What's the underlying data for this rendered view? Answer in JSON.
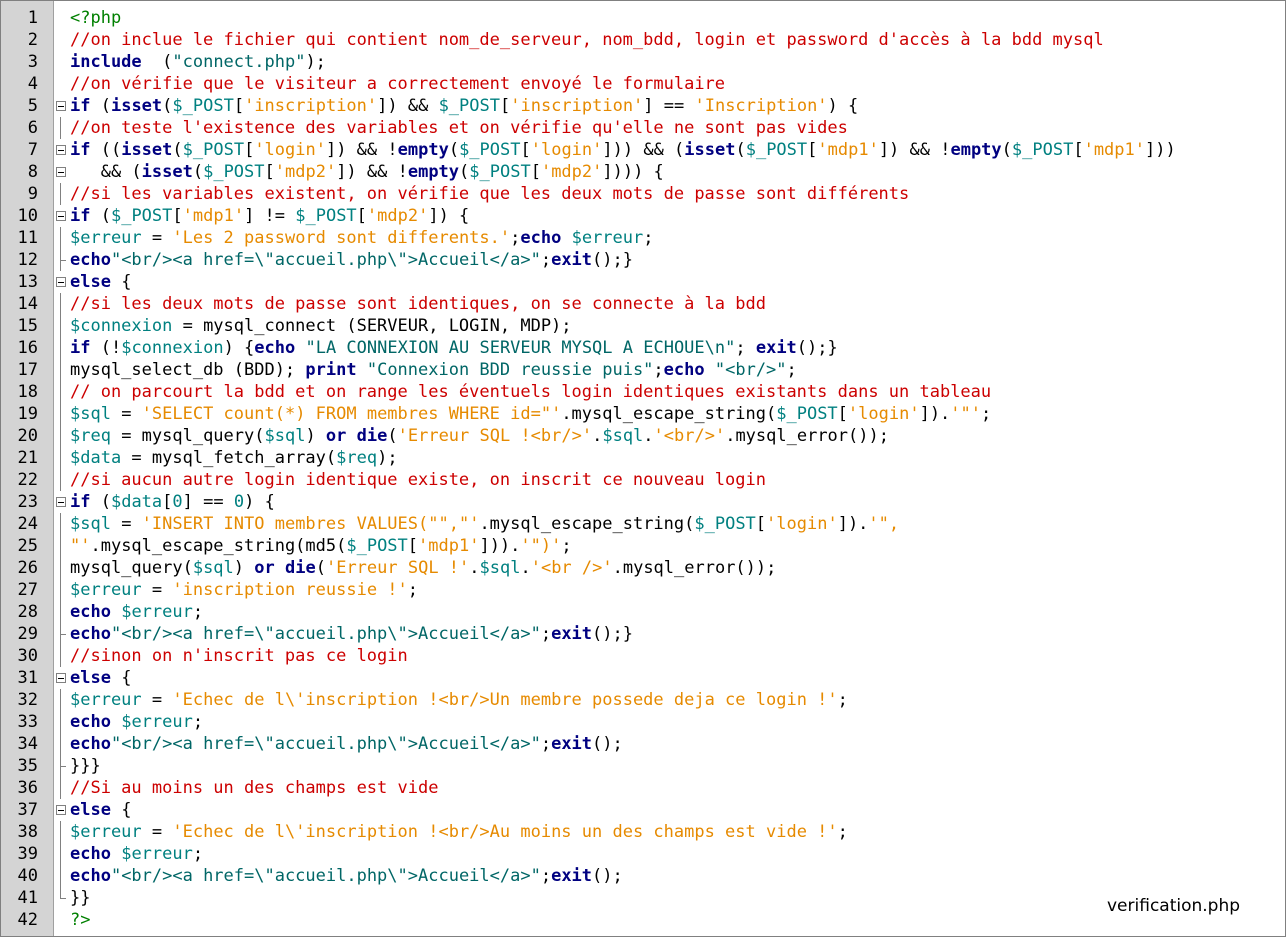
{
  "file": {
    "name": "verification.php"
  },
  "colors": {
    "comment": "#cc0000",
    "keyword": "#000080",
    "string_double": "#006666",
    "string_single": "#e68a00",
    "variable": "#008080",
    "php_tag": "#008000",
    "gutter_bg": "#d4d4d4"
  },
  "lines": [
    {
      "n": "1",
      "tokens": [
        [
          "tg",
          "<?php"
        ]
      ]
    },
    {
      "n": "2",
      "tokens": [
        [
          "cm",
          "//on inclue le fichier qui contient nom_de_serveur, nom_bdd, login et password d'accès à la bdd mysql"
        ]
      ]
    },
    {
      "n": "3",
      "tokens": [
        [
          "kw",
          "include"
        ],
        [
          "",
          "  ("
        ],
        [
          "st",
          "\"connect.php\""
        ],
        [
          "",
          ");"
        ]
      ]
    },
    {
      "n": "4",
      "tokens": [
        [
          "cm",
          "//on vérifie que le visiteur a correctement envoyé le formulaire"
        ]
      ]
    },
    {
      "n": "5",
      "tokens": [
        [
          "kw",
          "if"
        ],
        [
          "",
          " ("
        ],
        [
          "kw",
          "isset"
        ],
        [
          "",
          "("
        ],
        [
          "vr",
          "$_POST"
        ],
        [
          "",
          "["
        ],
        [
          "sq",
          "'inscription'"
        ],
        [
          "",
          "]) && "
        ],
        [
          "vr",
          "$_POST"
        ],
        [
          "",
          "["
        ],
        [
          "sq",
          "'inscription'"
        ],
        [
          "",
          "] == "
        ],
        [
          "sq",
          "'Inscription'"
        ],
        [
          "",
          ") {"
        ]
      ]
    },
    {
      "n": "6",
      "tokens": [
        [
          "cm",
          "//on teste l'existence des variables et on vérifie qu'elle ne sont pas vides"
        ]
      ]
    },
    {
      "n": "7",
      "tokens": [
        [
          "kw",
          "if"
        ],
        [
          "",
          " (("
        ],
        [
          "kw",
          "isset"
        ],
        [
          "",
          "("
        ],
        [
          "vr",
          "$_POST"
        ],
        [
          "",
          "["
        ],
        [
          "sq",
          "'login'"
        ],
        [
          "",
          "]) && !"
        ],
        [
          "kw",
          "empty"
        ],
        [
          "",
          "("
        ],
        [
          "vr",
          "$_POST"
        ],
        [
          "",
          "["
        ],
        [
          "sq",
          "'login'"
        ],
        [
          "",
          "])) && ("
        ],
        [
          "kw",
          "isset"
        ],
        [
          "",
          "("
        ],
        [
          "vr",
          "$_POST"
        ],
        [
          "",
          "["
        ],
        [
          "sq",
          "'mdp1'"
        ],
        [
          "",
          "]) && !"
        ],
        [
          "kw",
          "empty"
        ],
        [
          "",
          "("
        ],
        [
          "vr",
          "$_POST"
        ],
        [
          "",
          "["
        ],
        [
          "sq",
          "'mdp1'"
        ],
        [
          "",
          "]))"
        ]
      ]
    },
    {
      "n": "8",
      "tokens": [
        [
          "",
          "   && ("
        ],
        [
          "kw",
          "isset"
        ],
        [
          "",
          "("
        ],
        [
          "vr",
          "$_POST"
        ],
        [
          "",
          "["
        ],
        [
          "sq",
          "'mdp2'"
        ],
        [
          "",
          "]) && !"
        ],
        [
          "kw",
          "empty"
        ],
        [
          "",
          "("
        ],
        [
          "vr",
          "$_POST"
        ],
        [
          "",
          "["
        ],
        [
          "sq",
          "'mdp2'"
        ],
        [
          "",
          "]))) {"
        ]
      ]
    },
    {
      "n": "9",
      "tokens": [
        [
          "cm",
          "//si les variables existent, on vérifie que les deux mots de passe sont différents"
        ]
      ]
    },
    {
      "n": "10",
      "tokens": [
        [
          "kw",
          "if"
        ],
        [
          "",
          " ("
        ],
        [
          "vr",
          "$_POST"
        ],
        [
          "",
          "["
        ],
        [
          "sq",
          "'mdp1'"
        ],
        [
          "",
          "] != "
        ],
        [
          "vr",
          "$_POST"
        ],
        [
          "",
          "["
        ],
        [
          "sq",
          "'mdp2'"
        ],
        [
          "",
          "]) {"
        ]
      ]
    },
    {
      "n": "11",
      "tokens": [
        [
          "vr",
          "$erreur"
        ],
        [
          "",
          " = "
        ],
        [
          "sq",
          "'Les 2 password sont differents.'"
        ],
        [
          "",
          ";"
        ],
        [
          "kw",
          "echo"
        ],
        [
          "",
          " "
        ],
        [
          "vr",
          "$erreur"
        ],
        [
          "",
          ";"
        ]
      ]
    },
    {
      "n": "12",
      "tokens": [
        [
          "kw",
          "echo"
        ],
        [
          "st",
          "\"<br/><a href=\\\"accueil.php\\\">Accueil</a>\""
        ],
        [
          "",
          ";"
        ],
        [
          "kw",
          "exit"
        ],
        [
          "",
          "();}"
        ]
      ]
    },
    {
      "n": "13",
      "tokens": [
        [
          "kw",
          "else"
        ],
        [
          "",
          " {"
        ]
      ]
    },
    {
      "n": "14",
      "tokens": [
        [
          "cm",
          "//si les deux mots de passe sont identiques, on se connecte à la bdd"
        ]
      ]
    },
    {
      "n": "15",
      "tokens": [
        [
          "vr",
          "$connexion"
        ],
        [
          "",
          " = mysql_connect (SERVEUR, LOGIN, MDP);"
        ]
      ]
    },
    {
      "n": "16",
      "tokens": [
        [
          "kw",
          "if"
        ],
        [
          "",
          " (!"
        ],
        [
          "vr",
          "$connexion"
        ],
        [
          "",
          ") {"
        ],
        [
          "kw",
          "echo"
        ],
        [
          "",
          " "
        ],
        [
          "st",
          "\"LA CONNEXION AU SERVEUR MYSQL A ECHOUE\\n\""
        ],
        [
          "",
          "; "
        ],
        [
          "kw",
          "exit"
        ],
        [
          "",
          "();}"
        ]
      ]
    },
    {
      "n": "17",
      "tokens": [
        [
          "",
          "mysql_select_db (BDD); "
        ],
        [
          "kw",
          "print"
        ],
        [
          "",
          " "
        ],
        [
          "st",
          "\"Connexion BDD reussie puis\""
        ],
        [
          "",
          ";"
        ],
        [
          "kw",
          "echo"
        ],
        [
          "",
          " "
        ],
        [
          "st",
          "\"<br/>\""
        ],
        [
          "",
          ";"
        ]
      ]
    },
    {
      "n": "18",
      "tokens": [
        [
          "cm",
          "// on parcourt la bdd et on range les éventuels login identiques existants dans un tableau"
        ]
      ]
    },
    {
      "n": "19",
      "tokens": [
        [
          "vr",
          "$sql"
        ],
        [
          "",
          " = "
        ],
        [
          "sq",
          "'SELECT count(*) FROM membres WHERE id=\"'"
        ],
        [
          "",
          ".mysql_escape_string("
        ],
        [
          "vr",
          "$_POST"
        ],
        [
          "",
          "["
        ],
        [
          "sq",
          "'login'"
        ],
        [
          "",
          "])."
        ],
        [
          "sq",
          "'\"'"
        ],
        [
          "",
          ";"
        ]
      ]
    },
    {
      "n": "20",
      "tokens": [
        [
          "vr",
          "$req"
        ],
        [
          "",
          " = mysql_query("
        ],
        [
          "vr",
          "$sql"
        ],
        [
          "",
          ") "
        ],
        [
          "kw",
          "or"
        ],
        [
          "",
          " "
        ],
        [
          "kw",
          "die"
        ],
        [
          "",
          "("
        ],
        [
          "sq",
          "'Erreur SQL !<br/>'"
        ],
        [
          "",
          "."
        ],
        [
          "vr",
          "$sql"
        ],
        [
          "",
          "."
        ],
        [
          "sq",
          "'<br/>'"
        ],
        [
          "",
          ".mysql_error());"
        ]
      ]
    },
    {
      "n": "21",
      "tokens": [
        [
          "vr",
          "$data"
        ],
        [
          "",
          " = mysql_fetch_array("
        ],
        [
          "vr",
          "$req"
        ],
        [
          "",
          ");"
        ]
      ]
    },
    {
      "n": "22",
      "tokens": [
        [
          "cm",
          "//si aucun autre login identique existe, on inscrit ce nouveau login"
        ]
      ]
    },
    {
      "n": "23",
      "tokens": [
        [
          "kw",
          "if"
        ],
        [
          "",
          " ("
        ],
        [
          "vr",
          "$data"
        ],
        [
          "",
          "["
        ],
        [
          "nm",
          "0"
        ],
        [
          "",
          "] == "
        ],
        [
          "nm",
          "0"
        ],
        [
          "",
          ") {"
        ]
      ]
    },
    {
      "n": "24",
      "tokens": [
        [
          "vr",
          "$sql"
        ],
        [
          "",
          " = "
        ],
        [
          "sq",
          "'INSERT INTO membres VALUES(\"\",\"'"
        ],
        [
          "",
          ".mysql_escape_string("
        ],
        [
          "vr",
          "$_POST"
        ],
        [
          "",
          "["
        ],
        [
          "sq",
          "'login'"
        ],
        [
          "",
          "])."
        ],
        [
          "sq",
          "'\","
        ]
      ]
    },
    {
      "n": "25",
      "tokens": [
        [
          "sq",
          "\"'"
        ],
        [
          "",
          ".mysql_escape_string(md5("
        ],
        [
          "vr",
          "$_POST"
        ],
        [
          "",
          "["
        ],
        [
          "sq",
          "'mdp1'"
        ],
        [
          "",
          "]))."
        ],
        [
          "sq",
          "'\")'"
        ],
        [
          "",
          ";"
        ]
      ]
    },
    {
      "n": "26",
      "tokens": [
        [
          "",
          "mysql_query("
        ],
        [
          "vr",
          "$sql"
        ],
        [
          "",
          ") "
        ],
        [
          "kw",
          "or"
        ],
        [
          "",
          " "
        ],
        [
          "kw",
          "die"
        ],
        [
          "",
          "("
        ],
        [
          "sq",
          "'Erreur SQL !'"
        ],
        [
          "",
          "."
        ],
        [
          "vr",
          "$sql"
        ],
        [
          "",
          "."
        ],
        [
          "sq",
          "'<br />'"
        ],
        [
          "",
          ".mysql_error());"
        ]
      ]
    },
    {
      "n": "27",
      "tokens": [
        [
          "vr",
          "$erreur"
        ],
        [
          "",
          " = "
        ],
        [
          "sq",
          "'inscription reussie !'"
        ],
        [
          "",
          ";"
        ]
      ]
    },
    {
      "n": "28",
      "tokens": [
        [
          "kw",
          "echo"
        ],
        [
          "",
          " "
        ],
        [
          "vr",
          "$erreur"
        ],
        [
          "",
          ";"
        ]
      ]
    },
    {
      "n": "29",
      "tokens": [
        [
          "kw",
          "echo"
        ],
        [
          "st",
          "\"<br/><a href=\\\"accueil.php\\\">Accueil</a>\""
        ],
        [
          "",
          ";"
        ],
        [
          "kw",
          "exit"
        ],
        [
          "",
          "();}"
        ]
      ]
    },
    {
      "n": "30",
      "tokens": [
        [
          "cm",
          "//sinon on n'inscrit pas ce login"
        ]
      ]
    },
    {
      "n": "31",
      "tokens": [
        [
          "kw",
          "else"
        ],
        [
          "",
          " {"
        ]
      ]
    },
    {
      "n": "32",
      "tokens": [
        [
          "vr",
          "$erreur"
        ],
        [
          "",
          " = "
        ],
        [
          "sq",
          "'Echec de l\\'inscription !<br/>Un membre possede deja ce login !'"
        ],
        [
          "",
          ";"
        ]
      ]
    },
    {
      "n": "33",
      "tokens": [
        [
          "kw",
          "echo"
        ],
        [
          "",
          " "
        ],
        [
          "vr",
          "$erreur"
        ],
        [
          "",
          ";"
        ]
      ]
    },
    {
      "n": "34",
      "tokens": [
        [
          "kw",
          "echo"
        ],
        [
          "st",
          "\"<br/><a href=\\\"accueil.php\\\">Accueil</a>\""
        ],
        [
          "",
          ";"
        ],
        [
          "kw",
          "exit"
        ],
        [
          "",
          "();"
        ]
      ]
    },
    {
      "n": "35",
      "tokens": [
        [
          "",
          "}}}"
        ]
      ]
    },
    {
      "n": "36",
      "tokens": [
        [
          "cm",
          "//Si au moins un des champs est vide"
        ]
      ]
    },
    {
      "n": "37",
      "tokens": [
        [
          "kw",
          "else"
        ],
        [
          "",
          " {"
        ]
      ]
    },
    {
      "n": "38",
      "tokens": [
        [
          "vr",
          "$erreur"
        ],
        [
          "",
          " = "
        ],
        [
          "sq",
          "'Echec de l\\'inscription !<br/>Au moins un des champs est vide !'"
        ],
        [
          "",
          ";"
        ]
      ]
    },
    {
      "n": "39",
      "tokens": [
        [
          "kw",
          "echo"
        ],
        [
          "",
          " "
        ],
        [
          "vr",
          "$erreur"
        ],
        [
          "",
          ";"
        ]
      ]
    },
    {
      "n": "40",
      "tokens": [
        [
          "kw",
          "echo"
        ],
        [
          "st",
          "\"<br/><a href=\\\"accueil.php\\\">Accueil</a>\""
        ],
        [
          "",
          ";"
        ],
        [
          "kw",
          "exit"
        ],
        [
          "",
          "();"
        ]
      ]
    },
    {
      "n": "41",
      "tokens": [
        [
          "",
          "}}"
        ]
      ]
    },
    {
      "n": "42",
      "tokens": [
        [
          "tg",
          "?>"
        ]
      ]
    }
  ],
  "fold": {
    "box_lines": [
      "5",
      "7",
      "8",
      "10",
      "13",
      "23",
      "31",
      "37"
    ],
    "line_lines": [
      "6",
      "9",
      "11",
      "12",
      "14",
      "15",
      "16",
      "17",
      "18",
      "19",
      "20",
      "21",
      "22",
      "24",
      "25",
      "26",
      "27",
      "28",
      "29",
      "30",
      "32",
      "33",
      "34",
      "35",
      "36",
      "38",
      "39",
      "40",
      "41"
    ],
    "corner_lines": [
      "12",
      "29",
      "35",
      "41"
    ]
  }
}
